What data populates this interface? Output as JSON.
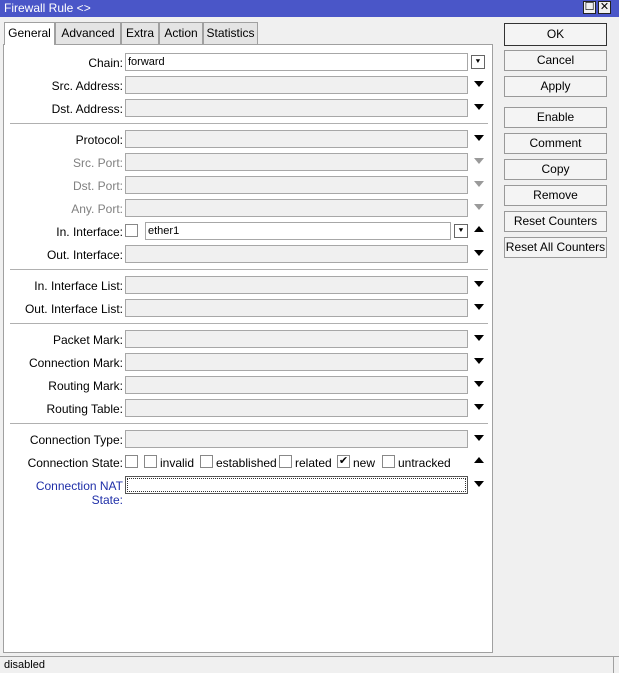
{
  "window": {
    "title": "Firewall Rule <>",
    "maximize_glyph": "☐",
    "close_glyph": "✕"
  },
  "tabs": [
    {
      "label": "General",
      "active": true
    },
    {
      "label": "Advanced"
    },
    {
      "label": "Extra"
    },
    {
      "label": "Action"
    },
    {
      "label": "Statistics"
    }
  ],
  "general": {
    "chain": {
      "label": "Chain:",
      "value": "forward"
    },
    "src_address": {
      "label": "Src. Address:"
    },
    "dst_address": {
      "label": "Dst. Address:"
    },
    "protocol": {
      "label": "Protocol:"
    },
    "src_port": {
      "label": "Src. Port:"
    },
    "dst_port": {
      "label": "Dst. Port:"
    },
    "any_port": {
      "label": "Any. Port:"
    },
    "in_interface": {
      "label": "In. Interface:",
      "value": "ether1"
    },
    "out_interface": {
      "label": "Out. Interface:"
    },
    "in_interface_list": {
      "label": "In. Interface List:"
    },
    "out_interface_list": {
      "label": "Out. Interface List:"
    },
    "packet_mark": {
      "label": "Packet Mark:"
    },
    "connection_mark": {
      "label": "Connection Mark:"
    },
    "routing_mark": {
      "label": "Routing Mark:"
    },
    "routing_table": {
      "label": "Routing Table:"
    },
    "connection_type": {
      "label": "Connection Type:"
    },
    "connection_state": {
      "label": "Connection State:",
      "options": [
        {
          "label": "invalid",
          "checked": false
        },
        {
          "label": "established",
          "checked": false
        },
        {
          "label": "related",
          "checked": false
        },
        {
          "label": "new",
          "checked": true,
          "mark": "✔"
        },
        {
          "label": "untracked",
          "checked": false
        }
      ]
    },
    "connection_nat_state": {
      "label": "Connection NAT State:"
    }
  },
  "buttons": {
    "ok": "OK",
    "cancel": "Cancel",
    "apply": "Apply",
    "enable": "Enable",
    "comment": "Comment",
    "copy": "Copy",
    "remove": "Remove",
    "reset_counters": "Reset Counters",
    "reset_all_counters": "Reset All Counters"
  },
  "status": {
    "text": "disabled"
  },
  "icons": {
    "dropdown": "⯆",
    "dropdown_button": "⯆"
  }
}
